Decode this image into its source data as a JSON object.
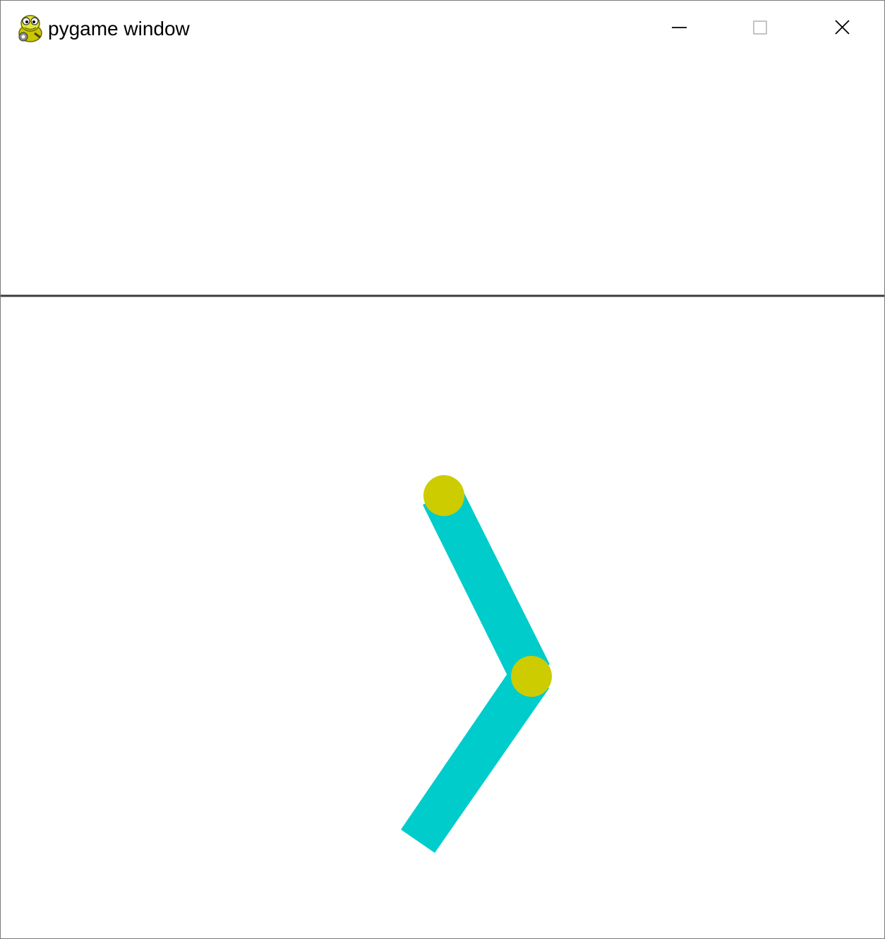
{
  "window": {
    "title": "pygame window",
    "app_icon": "pygame-snake-icon",
    "controls": {
      "minimize_icon": "minimize-icon",
      "maximize_icon": "maximize-icon",
      "close_icon": "close-icon"
    }
  },
  "scene": {
    "background_color": "#ffffff",
    "ground_line_color": "#3c3c3c",
    "arm_color": "#00cccc",
    "joint_color": "#cccc00",
    "segments": 2,
    "joints": 2
  }
}
